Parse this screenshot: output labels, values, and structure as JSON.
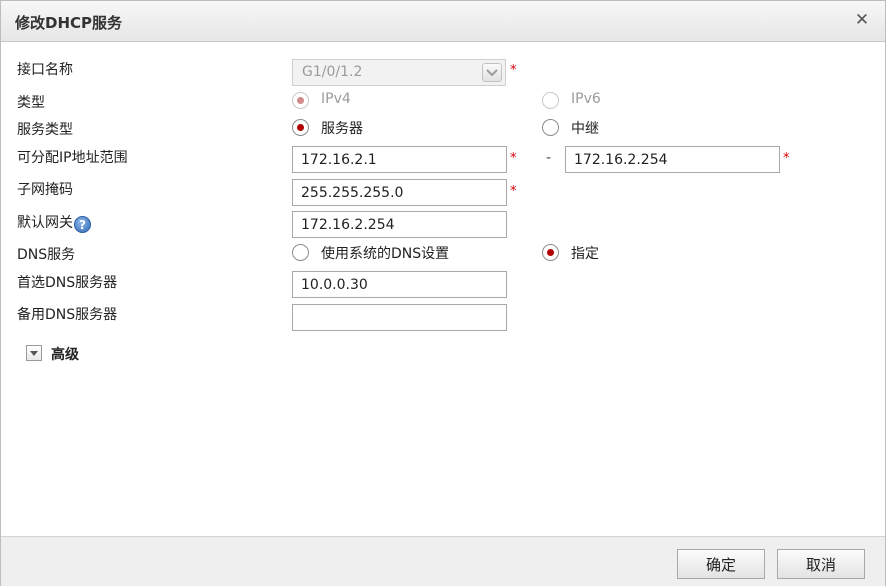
{
  "dialog": {
    "title": "修改DHCP服务",
    "close_icon": "close-icon"
  },
  "form": {
    "interface_name": {
      "label": "接口名称",
      "value": "G1/0/1.2",
      "required": "*"
    },
    "type": {
      "label": "类型",
      "options": [
        "IPv4",
        "IPv6"
      ],
      "selected": "IPv4",
      "disabled": true
    },
    "service_type": {
      "label": "服务类型",
      "options": [
        "服务器",
        "中继"
      ],
      "selected": "服务器"
    },
    "ip_range": {
      "label": "可分配IP地址范围",
      "start": "172.16.2.1",
      "separator": "-",
      "end": "172.16.2.254",
      "required": "*"
    },
    "subnet_mask": {
      "label": "子网掩码",
      "value": "255.255.255.0",
      "required": "*"
    },
    "default_gateway": {
      "label": "默认网关",
      "help_icon": "?",
      "value": "172.16.2.254"
    },
    "dns_service": {
      "label": "DNS服务",
      "options": [
        "使用系统的DNS设置",
        "指定"
      ],
      "selected": "指定"
    },
    "primary_dns": {
      "label": "首选DNS服务器",
      "value": "10.0.0.30"
    },
    "secondary_dns": {
      "label": "备用DNS服务器",
      "value": ""
    }
  },
  "advanced": {
    "label": "高级",
    "expanded": false
  },
  "footer": {
    "ok_label": "确定",
    "cancel_label": "取消"
  },
  "colors": {
    "required": "#d40000",
    "radio_selected": "#b00000",
    "titlebar": "#ececec",
    "footer": "#efefef"
  }
}
